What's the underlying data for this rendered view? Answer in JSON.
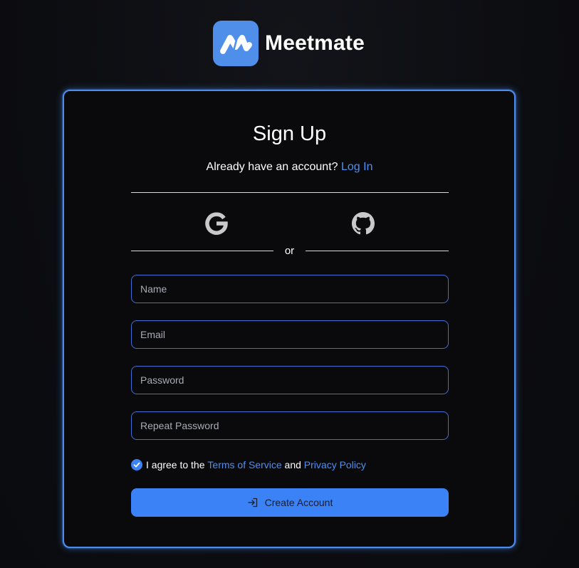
{
  "brand": {
    "name": "Meetmate",
    "color": "#4f8fe9",
    "logo_icon": "meetmate-logo-icon"
  },
  "form": {
    "title": "Sign Up",
    "subtitle_text": "Already have an account?",
    "login_link": "Log In",
    "social_providers": [
      {
        "name": "google",
        "icon": "google-icon"
      },
      {
        "name": "github",
        "icon": "github-icon"
      }
    ],
    "divider_text": "or",
    "fields": {
      "name": {
        "placeholder": "Name",
        "value": ""
      },
      "email": {
        "placeholder": "Email",
        "value": ""
      },
      "password": {
        "placeholder": "Password",
        "value": ""
      },
      "repeat_password": {
        "placeholder": "Repeat Password",
        "value": ""
      }
    },
    "agreement": {
      "checked": true,
      "prefix": "I agree to the",
      "terms_link": "Terms of Service",
      "conjunction": "and",
      "privacy_link": "Privacy Policy"
    },
    "submit": {
      "label": "Create Account",
      "icon": "login-icon"
    }
  },
  "colors": {
    "accent": "#3b82f6",
    "link": "#4d8ff0",
    "card_border": "#4a8cf0",
    "background": "#0c0d11"
  }
}
